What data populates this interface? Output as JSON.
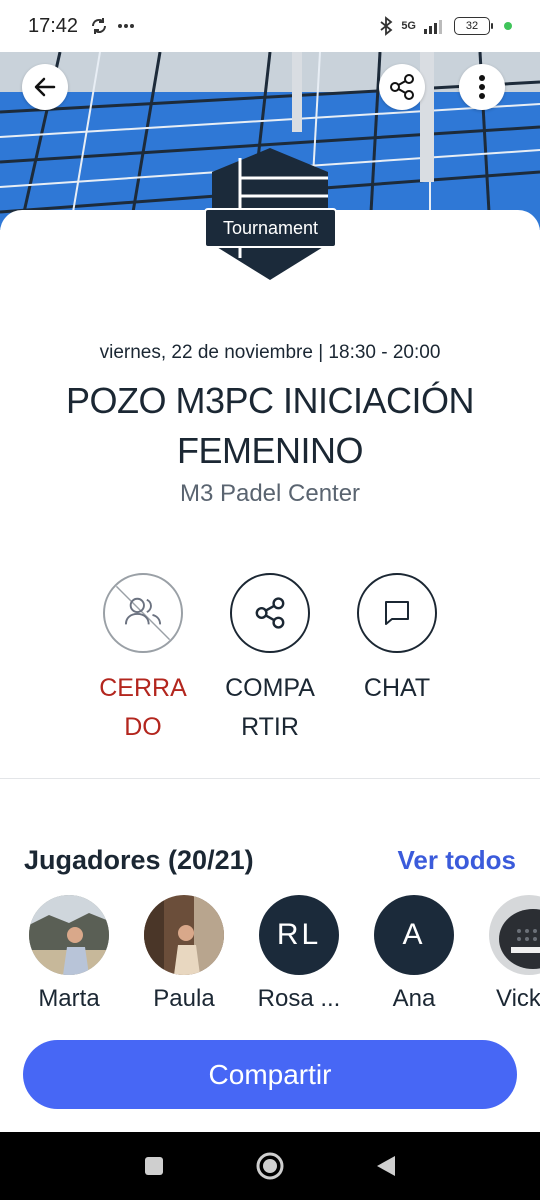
{
  "status_bar": {
    "time": "17:42",
    "network": "5G",
    "battery": "32"
  },
  "header": {
    "back_icon": "arrow-left-icon",
    "share_icon": "share-icon",
    "more_icon": "more-vertical-icon"
  },
  "event": {
    "badge": "Tournament",
    "date": "viernes, 22 de noviembre | 18:30 - 20:00",
    "title": "POZO M3PC INICIACIÓN FEMENINO",
    "venue": "M3 Padel Center"
  },
  "actions": [
    {
      "label": "CERRADO",
      "icon": "users-crossed-icon",
      "color": "#b3261e"
    },
    {
      "label": "COMPARTIR",
      "icon": "share-icon"
    },
    {
      "label": "CHAT",
      "icon": "chat-icon"
    }
  ],
  "players": {
    "title": "Jugadores (20/21)",
    "see_all": "Ver todos",
    "list": [
      {
        "name": "Marta",
        "avatar": "photo"
      },
      {
        "name": "Paula",
        "avatar": "photo"
      },
      {
        "name": "Rosa ...",
        "initials": "RL"
      },
      {
        "name": "Ana",
        "initials": "A"
      },
      {
        "name": "Vick",
        "avatar": "photo"
      }
    ]
  },
  "cta": {
    "label": "Compartir"
  },
  "colors": {
    "accent": "#4767f5",
    "link": "#3b5bdb",
    "dark": "#1b2a3a",
    "closed": "#b3261e"
  }
}
